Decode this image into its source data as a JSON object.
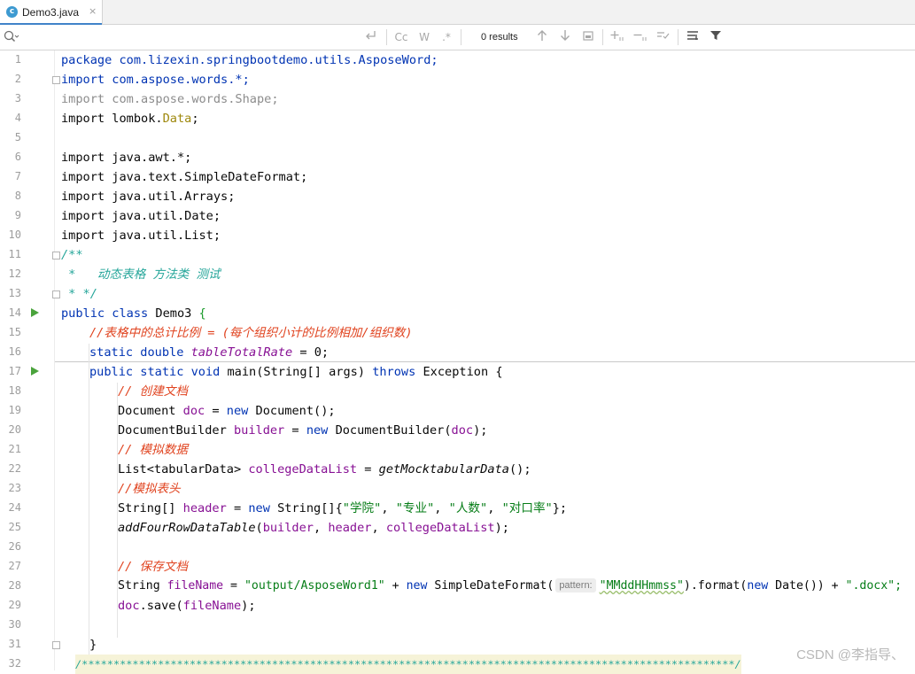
{
  "tab": {
    "file_name": "Demo3.java",
    "icon": "c",
    "close": "×"
  },
  "search": {
    "placeholder": "",
    "results": "0 results"
  },
  "toolbar": {
    "match_case": "Cc",
    "words": "W",
    "regex": ".*"
  },
  "hint": {
    "pattern": "pattern:"
  },
  "watermark": "CSDN @李指导、",
  "code_lines": [
    {
      "n": "1"
    },
    {
      "n": "2"
    },
    {
      "n": "3"
    },
    {
      "n": "4"
    },
    {
      "n": "5"
    },
    {
      "n": "6"
    },
    {
      "n": "7"
    },
    {
      "n": "8"
    },
    {
      "n": "9"
    },
    {
      "n": "10"
    },
    {
      "n": "11"
    },
    {
      "n": "12"
    },
    {
      "n": "13"
    },
    {
      "n": "14"
    },
    {
      "n": "15"
    },
    {
      "n": "16"
    },
    {
      "n": "17"
    },
    {
      "n": "18"
    },
    {
      "n": "19"
    },
    {
      "n": "20"
    },
    {
      "n": "21"
    },
    {
      "n": "22"
    },
    {
      "n": "23"
    },
    {
      "n": "24"
    },
    {
      "n": "25"
    },
    {
      "n": "26"
    },
    {
      "n": "27"
    },
    {
      "n": "28"
    },
    {
      "n": "29"
    },
    {
      "n": "30"
    },
    {
      "n": "31"
    },
    {
      "n": "32"
    }
  ],
  "code": {
    "l1": "package com.lizexin.springbootdemo.utils.AsposeWord;",
    "l2": "import com.aspose.words.*;",
    "l3": "import com.aspose.words.Shape;",
    "l4_a": "import lombok.",
    "l4_b": "Data",
    "l4_c": ";",
    "l6": "import java.awt.*;",
    "l7": "import java.text.SimpleDateFormat;",
    "l8": "import java.util.Arrays;",
    "l9": "import java.util.Date;",
    "l10": "import java.util.List;",
    "l11": "/**",
    "l12": " *   动态表格 方法类 测试",
    "l13": " * */",
    "l14_a": "public class ",
    "l14_b": "Demo3 ",
    "l14_c": "{",
    "l15": "//表格中的总计比例 = (每个组织小计的比例相加/组织数)",
    "l16_a": "static double ",
    "l16_b": "tableTotalRate",
    "l16_c": " = 0;",
    "l17_a": "public static void ",
    "l17_b": "main(String[] args) ",
    "l17_c": "throws ",
    "l17_d": "Exception {",
    "l18": "// 创建文档",
    "l19_a": "Document ",
    "l19_b": "doc",
    "l19_c": " = ",
    "l19_d": "new ",
    "l19_e": "Document();",
    "l20_a": "DocumentBuilder ",
    "l20_b": "builder",
    "l20_c": " = ",
    "l20_d": "new ",
    "l20_e": "DocumentBuilder(",
    "l20_f": "doc",
    "l20_g": ");",
    "l21": "// 模拟数据",
    "l22_a": "List<tabularData> ",
    "l22_b": "collegeDataList",
    "l22_c": " = ",
    "l22_d": "getMocktabularData",
    "l22_e": "();",
    "l23": "//模拟表头",
    "l24_a": "String[] ",
    "l24_b": "header",
    "l24_c": " = ",
    "l24_d": "new ",
    "l24_e": "String[]{",
    "l24_f": "\"学院\"",
    "l24_g": ", ",
    "l24_h": "\"专业\"",
    "l24_i": ", ",
    "l24_j": "\"人数\"",
    "l24_k": ", ",
    "l24_l": "\"对口率\"",
    "l24_m": "};",
    "l25_a": "addFourRowDataTable",
    "l25_b": "(",
    "l25_c": "builder",
    "l25_d": ", ",
    "l25_e": "header",
    "l25_f": ", ",
    "l25_g": "collegeDataList",
    "l25_h": ");",
    "l27": "// 保存文档",
    "l28_a": "String ",
    "l28_b": "fileName",
    "l28_c": " = ",
    "l28_d": "\"output/AsposeWord1\"",
    "l28_e": " + ",
    "l28_f": "new ",
    "l28_g": "SimpleDateFormat(",
    "l28_h": "\"MMddHHmmss\"",
    "l28_i": ").format(",
    "l28_j": "new ",
    "l28_k": "Date()) + ",
    "l28_l": "\".docx\";",
    "l29_a": "doc",
    "l29_b": ".save(",
    "l29_c": "fileName",
    "l29_d": ");",
    "l31": "}",
    "l32": "/*******************************************************************************************************/"
  }
}
